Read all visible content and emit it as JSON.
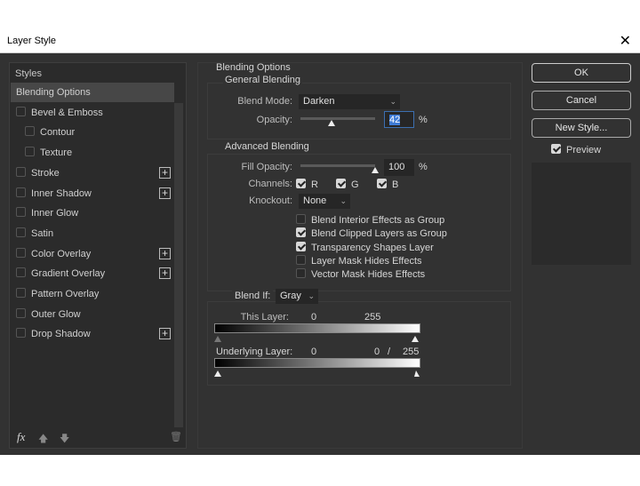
{
  "window": {
    "title": "Layer Style",
    "close": "✕"
  },
  "styles": {
    "header": "Styles",
    "items": [
      {
        "label": "Blending Options",
        "checkbox": false,
        "plus": false,
        "selected": true
      },
      {
        "label": "Bevel & Emboss",
        "checkbox": true,
        "checked": false
      },
      {
        "label": "Contour",
        "checkbox": true,
        "checked": false,
        "indent": true
      },
      {
        "label": "Texture",
        "checkbox": true,
        "checked": false,
        "indent": true
      },
      {
        "label": "Stroke",
        "checkbox": true,
        "checked": false,
        "plus": true
      },
      {
        "label": "Inner Shadow",
        "checkbox": true,
        "checked": false,
        "plus": true
      },
      {
        "label": "Inner Glow",
        "checkbox": true,
        "checked": false
      },
      {
        "label": "Satin",
        "checkbox": true,
        "checked": false
      },
      {
        "label": "Color Overlay",
        "checkbox": true,
        "checked": false,
        "plus": true
      },
      {
        "label": "Gradient Overlay",
        "checkbox": true,
        "checked": false,
        "plus": true
      },
      {
        "label": "Pattern Overlay",
        "checkbox": true,
        "checked": false
      },
      {
        "label": "Outer Glow",
        "checkbox": true,
        "checked": false
      },
      {
        "label": "Drop Shadow",
        "checkbox": true,
        "checked": false,
        "plus": true
      }
    ],
    "fx": "fx"
  },
  "blending": {
    "title": "Blending Options",
    "general": {
      "title": "General Blending",
      "blend_mode_label": "Blend Mode:",
      "blend_mode": "Darken",
      "opacity_label": "Opacity:",
      "opacity": "42",
      "opacity_pct": 42,
      "pct": "%"
    },
    "advanced": {
      "title": "Advanced Blending",
      "fill_label": "Fill Opacity:",
      "fill": "100",
      "fill_pct": 100,
      "pct": "%",
      "channels_label": "Channels:",
      "channels": [
        "R",
        "G",
        "B"
      ],
      "knockout_label": "Knockout:",
      "knockout": "None",
      "options": [
        {
          "label": "Blend Interior Effects as Group",
          "checked": false
        },
        {
          "label": "Blend Clipped Layers as Group",
          "checked": true
        },
        {
          "label": "Transparency Shapes Layer",
          "checked": true
        },
        {
          "label": "Layer Mask Hides Effects",
          "checked": false
        },
        {
          "label": "Vector Mask Hides Effects",
          "checked": false
        }
      ]
    },
    "blend_if": {
      "label": "Blend If:",
      "value": "Gray",
      "this_label": "This Layer:",
      "this_min": "0",
      "this_max": "255",
      "under_label": "Underlying Layer:",
      "under_min": "0",
      "under_split": "0",
      "slash": "/",
      "under_max": "255"
    }
  },
  "buttons": {
    "ok": "OK",
    "cancel": "Cancel",
    "new_style": "New Style...",
    "preview": "Preview"
  }
}
